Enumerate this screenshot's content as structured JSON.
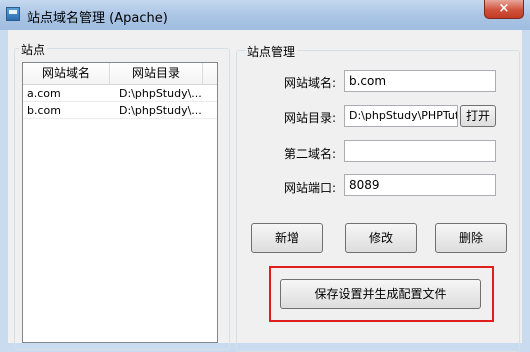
{
  "window": {
    "title": "站点域名管理 (Apache)",
    "close_glyph": "×"
  },
  "sites_panel": {
    "group_label": "站点",
    "columns": [
      "网站域名",
      "网站目录"
    ],
    "rows": [
      {
        "domain": "a.com",
        "dir": "D:\\phpStudy\\..."
      },
      {
        "domain": "b.com",
        "dir": "D:\\phpStudy\\..."
      }
    ]
  },
  "manage_panel": {
    "group_label": "站点管理",
    "domain_label": "网站域名:",
    "domain_value": "b.com",
    "dir_label": "网站目录:",
    "dir_value": "D:\\phpStudy\\PHPTutor",
    "browse_button": "打开",
    "second_domain_label": "第二域名:",
    "second_domain_value": "",
    "port_label": "网站端口:",
    "port_value": "8089",
    "add_button": "新增",
    "edit_button": "修改",
    "delete_button": "删除",
    "save_button": "保存设置并生成配置文件"
  },
  "colors": {
    "highlight": "#e01e1e",
    "title_bar": "#a9c4e4",
    "close_button": "#d0533c"
  }
}
